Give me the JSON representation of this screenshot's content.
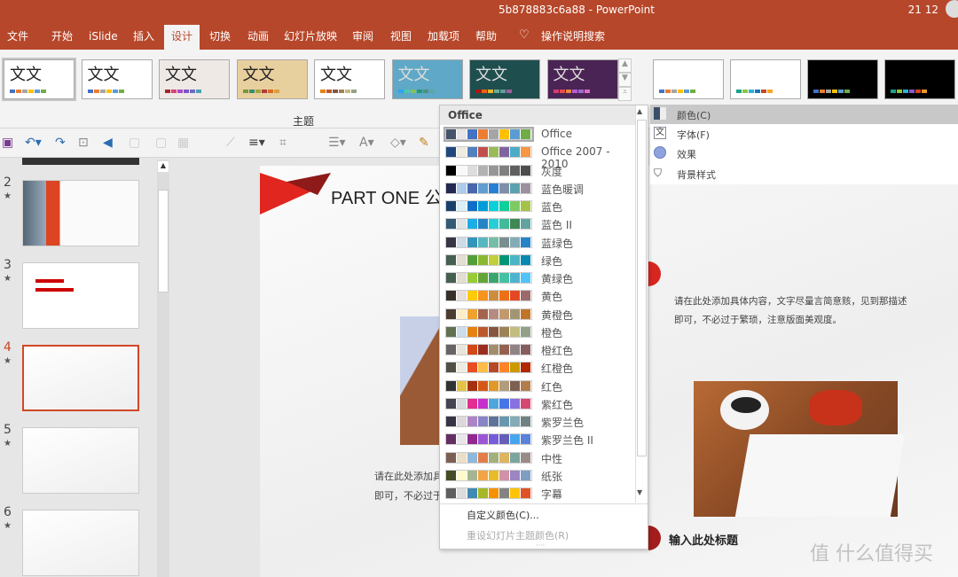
{
  "window": {
    "title": "5b878883c6a88  -  PowerPoint",
    "clock": "21 12"
  },
  "tabs": [
    "文件",
    "开始",
    "iSlide",
    "插入",
    "设计",
    "切换",
    "动画",
    "幻灯片放映",
    "审阅",
    "视图",
    "加载项",
    "帮助",
    "操作说明搜索"
  ],
  "active_tab": "设计",
  "themes": [
    {
      "glyph": "文文",
      "bg": "#ffffff",
      "colors": [
        "#4472c4",
        "#ed7d31",
        "#a5a5a5",
        "#ffc000",
        "#5b9bd5",
        "#70ad47"
      ]
    },
    {
      "glyph": "文文",
      "bg": "#ffffff",
      "colors": [
        "#4472c4",
        "#ed7d31",
        "#a5a5a5",
        "#ffc000",
        "#5b9bd5",
        "#70ad47"
      ]
    },
    {
      "glyph": "文文",
      "bg": "#efe9e6",
      "colors": [
        "#a4262c",
        "#d6437b",
        "#a64dc4",
        "#7d55c7",
        "#6c6bbd",
        "#4aa0b5"
      ]
    },
    {
      "glyph": "文文",
      "bg": "#e8cf9e",
      "colors": [
        "#6f9a3c",
        "#3c8c72",
        "#a3a53a",
        "#b23b3b",
        "#d86d25",
        "#d7a13a"
      ]
    },
    {
      "glyph": "文文",
      "bg": "#ffffff",
      "colors": [
        "#e48312",
        "#bd582c",
        "#865640",
        "#9b8357",
        "#c2bc80",
        "#94a088"
      ]
    },
    {
      "glyph": "文文",
      "bg": "#5fa8c7",
      "colors": [
        "#2fa3ee",
        "#4bcaad",
        "#86c157",
        "#1f9d67",
        "#4f8f81",
        "#5da6a7"
      ]
    },
    {
      "glyph": "文文",
      "bg": "#1f4e4e",
      "colors": [
        "#b01513",
        "#ea6312",
        "#e6b729",
        "#6aac90",
        "#5f9c9d",
        "#9e5e9b"
      ]
    },
    {
      "glyph": "文文",
      "bg": "#4a2454",
      "colors": [
        "#d83a73",
        "#e64e4e",
        "#e58b3c",
        "#bb5cd1",
        "#9c6bd6",
        "#dd6cc6"
      ]
    }
  ],
  "theme_group_label": "主题",
  "variants": [
    {
      "bg": "#ffffff",
      "colors": [
        "#4472c4",
        "#ed7d31",
        "#a5a5a5",
        "#ffc000",
        "#5b9bd5",
        "#70ad47"
      ]
    },
    {
      "bg": "#ffffff",
      "colors": [
        "#1ba18a",
        "#8dc63f",
        "#2fb1d8",
        "#1e73be",
        "#c44a1f",
        "#f5a623"
      ]
    },
    {
      "bg": "#000000",
      "colors": [
        "#4472c4",
        "#ed7d31",
        "#a5a5a5",
        "#ffc000",
        "#5b9bd5",
        "#70ad47"
      ]
    },
    {
      "bg": "#000000",
      "colors": [
        "#1ba18a",
        "#8dc63f",
        "#2fb1d8",
        "#8e58c9",
        "#d2461e",
        "#e89a2a"
      ]
    }
  ],
  "color_menu": {
    "header": "Office",
    "selected": "Office",
    "schemes": [
      {
        "name": "Office",
        "colors": [
          "#44546a",
          "#e7e6e6",
          "#4472c4",
          "#ed7d31",
          "#a5a5a5",
          "#ffc000",
          "#5b9bd5",
          "#70ad47"
        ]
      },
      {
        "name": "Office 2007 - 2010",
        "colors": [
          "#1f497d",
          "#eeece1",
          "#4f81bd",
          "#c0504d",
          "#9bbb59",
          "#8064a2",
          "#4bacc6",
          "#f79646"
        ]
      },
      {
        "name": "灰度",
        "colors": [
          "#000000",
          "#f8f8f8",
          "#dddddd",
          "#b2b2b2",
          "#969696",
          "#808080",
          "#5f5f5f",
          "#4d4d4d"
        ]
      },
      {
        "name": "蓝色暖调",
        "colors": [
          "#242852",
          "#acccea",
          "#4a66ac",
          "#629dd1",
          "#297fd5",
          "#7f8fa9",
          "#5aa2ae",
          "#9d90a0"
        ]
      },
      {
        "name": "蓝色",
        "colors": [
          "#17406d",
          "#dbeff9",
          "#0f6fc6",
          "#009dd9",
          "#0bd0d9",
          "#10cf9b",
          "#7cca62",
          "#a5c249"
        ]
      },
      {
        "name": "蓝色 II",
        "colors": [
          "#335b74",
          "#dfe3e5",
          "#1cade4",
          "#2683c6",
          "#27ced7",
          "#42ba97",
          "#3e8853",
          "#62a39f"
        ]
      },
      {
        "name": "蓝绿色",
        "colors": [
          "#373545",
          "#cedbe6",
          "#3494ba",
          "#58b6c0",
          "#75bda7",
          "#7a8c8e",
          "#84acb6",
          "#2683c6"
        ]
      },
      {
        "name": "绿色",
        "colors": [
          "#455f51",
          "#e3ded1",
          "#549e39",
          "#8ab833",
          "#c0cf3a",
          "#029676",
          "#4ab5c4",
          "#0989b1"
        ]
      },
      {
        "name": "黄绿色",
        "colors": [
          "#455f51",
          "#e3ded1",
          "#99cb38",
          "#63a537",
          "#37a76f",
          "#44c1a3",
          "#4eb3cf",
          "#51c3f9"
        ]
      },
      {
        "name": "黄色",
        "colors": [
          "#39302a",
          "#e5dedb",
          "#ffca08",
          "#f8931d",
          "#ce8d3e",
          "#ec7016",
          "#e64823",
          "#9c6a6a"
        ]
      },
      {
        "name": "黄橙色",
        "colors": [
          "#4e3b30",
          "#fbeec9",
          "#f0a22e",
          "#a5644e",
          "#b58b80",
          "#c3986d",
          "#a19574",
          "#c17529"
        ]
      },
      {
        "name": "橙色",
        "colors": [
          "#637052",
          "#ccddea",
          "#e48312",
          "#bd582c",
          "#865640",
          "#9b8357",
          "#c2bc80",
          "#94a088"
        ]
      },
      {
        "name": "橙红色",
        "colors": [
          "#696464",
          "#e9e5dc",
          "#d34817",
          "#9b2d1f",
          "#a28e6a",
          "#956251",
          "#918485",
          "#855d5d"
        ]
      },
      {
        "name": "红橙色",
        "colors": [
          "#505046",
          "#eeece1",
          "#e84c22",
          "#ffbd47",
          "#b64926",
          "#ff8427",
          "#cc9900",
          "#b22600"
        ]
      },
      {
        "name": "红色",
        "colors": [
          "#323232",
          "#e5c243",
          "#a5300f",
          "#d55816",
          "#e19825",
          "#b19c7d",
          "#7f5f52",
          "#b27d49"
        ]
      },
      {
        "name": "紫红色",
        "colors": [
          "#454551",
          "#d8d9dc",
          "#e32d91",
          "#c830cc",
          "#4ea6dc",
          "#4775e7",
          "#8971e1",
          "#d54773"
        ]
      },
      {
        "name": "紫罗兰色",
        "colors": [
          "#373545",
          "#dcd8dc",
          "#ad84c6",
          "#8784c7",
          "#5d739a",
          "#6997af",
          "#84acb6",
          "#6f8183"
        ]
      },
      {
        "name": "紫罗兰色 II",
        "colors": [
          "#632e62",
          "#eae5eb",
          "#92278f",
          "#9b57d3",
          "#755dd9",
          "#665eb8",
          "#45a5ed",
          "#5982db"
        ]
      },
      {
        "name": "中性",
        "colors": [
          "#7c5f52",
          "#ebdfc8",
          "#8eb8dc",
          "#e27d48",
          "#a4b07c",
          "#ddb45f",
          "#7ca59f",
          "#9b8b87"
        ]
      },
      {
        "name": "纸张",
        "colors": [
          "#444d26",
          "#fefac9",
          "#a5b592",
          "#f3a447",
          "#e7bc29",
          "#d092a7",
          "#9c85c0",
          "#809ec2"
        ]
      },
      {
        "name": "字幕",
        "colors": [
          "#5e5e5e",
          "#dddddd",
          "#418ab3",
          "#a6b727",
          "#f69200",
          "#838383",
          "#fec306",
          "#df5327"
        ]
      }
    ],
    "custom_label": "自定义颜色(C)...",
    "reset_label": "重设幻灯片主题颜色(R)"
  },
  "variant_menu": [
    "颜色(C)",
    "字体(F)",
    "效果",
    "背景样式"
  ],
  "slide_panel": {
    "numbers": [
      "2",
      "3",
      "4",
      "5",
      "6"
    ],
    "active": "4"
  },
  "slide": {
    "title": "PART ONE 公",
    "body_right": [
      "请在此处添加具体内容，文字尽量言简意赅，见到那描述",
      "即可，不必过于繁琐，注意版面美观度。"
    ],
    "body_left": [
      "请在此处添加具",
      "即可，不必过于"
    ],
    "subtitle": "输入此处标题",
    "watermark": "值 什么值得买"
  }
}
